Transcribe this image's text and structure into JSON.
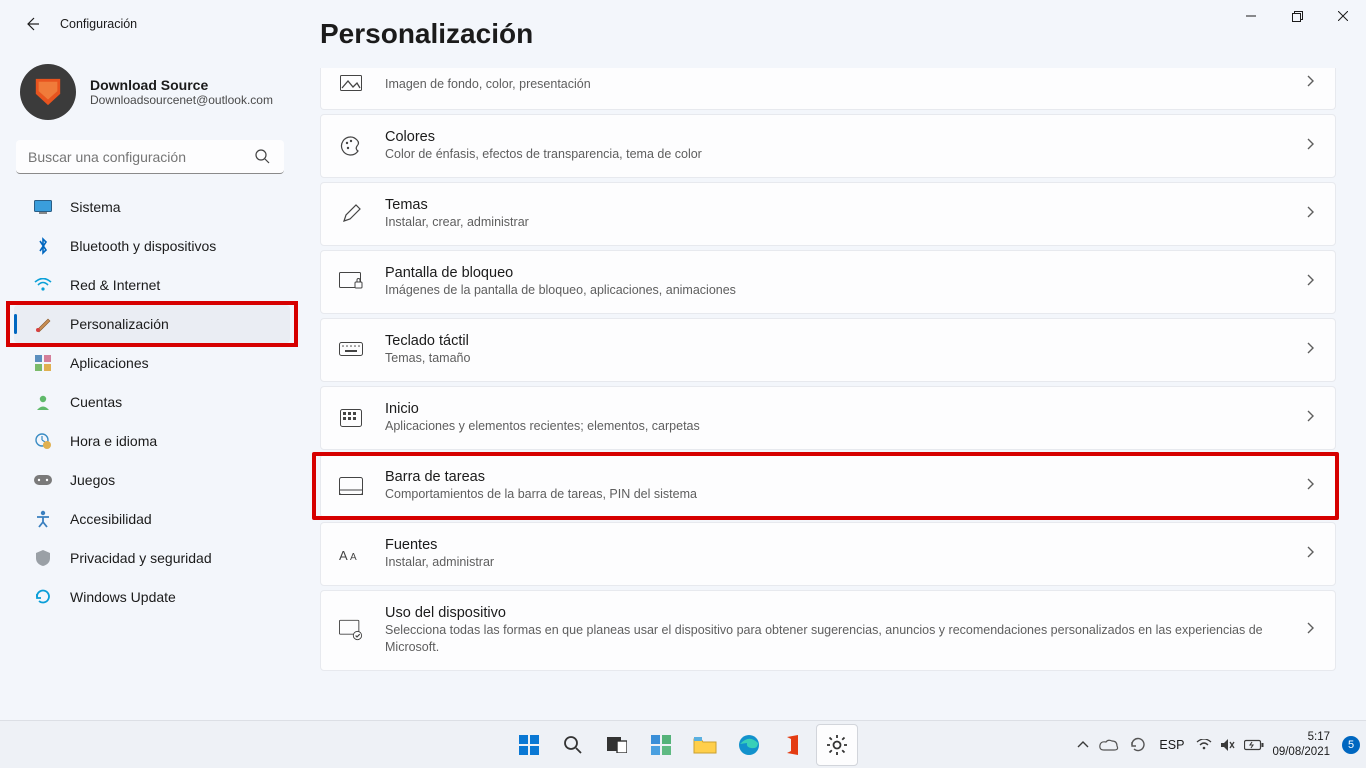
{
  "titlebar": {
    "app_name": "Configuración"
  },
  "user": {
    "name": "Download Source",
    "email": "Downloadsourcenet@outlook.com"
  },
  "search": {
    "placeholder": "Buscar una configuración"
  },
  "nav": {
    "items": [
      {
        "label": "Sistema",
        "icon": "monitor-icon"
      },
      {
        "label": "Bluetooth y dispositivos",
        "icon": "bluetooth-icon"
      },
      {
        "label": "Red & Internet",
        "icon": "wifi-icon"
      },
      {
        "label": "Personalización",
        "icon": "brush-icon",
        "selected": true,
        "annotated": true
      },
      {
        "label": "Aplicaciones",
        "icon": "apps-icon"
      },
      {
        "label": "Cuentas",
        "icon": "person-icon"
      },
      {
        "label": "Hora e idioma",
        "icon": "globe-clock-icon"
      },
      {
        "label": "Juegos",
        "icon": "gamepad-icon"
      },
      {
        "label": "Accesibilidad",
        "icon": "accessibility-icon"
      },
      {
        "label": "Privacidad y seguridad",
        "icon": "shield-icon"
      },
      {
        "label": "Windows Update",
        "icon": "update-icon"
      }
    ]
  },
  "page": {
    "title": "Personalización",
    "cards": [
      {
        "title": "",
        "desc": "Imagen de fondo, color, presentación",
        "icon": "background-icon",
        "truncated_top": true
      },
      {
        "title": "Colores",
        "desc": "Color de énfasis, efectos de transparencia, tema de color",
        "icon": "palette-icon"
      },
      {
        "title": "Temas",
        "desc": "Instalar, crear, administrar",
        "icon": "pen-icon"
      },
      {
        "title": "Pantalla de bloqueo",
        "desc": "Imágenes de la pantalla de bloqueo, aplicaciones, animaciones",
        "icon": "lockscreen-icon"
      },
      {
        "title": "Teclado táctil",
        "desc": "Temas, tamaño",
        "icon": "keyboard-touch-icon"
      },
      {
        "title": "Inicio",
        "desc": "Aplicaciones y elementos recientes; elementos, carpetas",
        "icon": "start-icon"
      },
      {
        "title": "Barra de tareas",
        "desc": "Comportamientos de la barra de tareas, PIN del sistema",
        "icon": "taskbar-icon",
        "annotated": true
      },
      {
        "title": "Fuentes",
        "desc": "Instalar, administrar",
        "icon": "font-icon"
      },
      {
        "title": "Uso del dispositivo",
        "desc": "Selecciona todas las formas en que planeas usar el dispositivo para obtener sugerencias, anuncios y recomendaciones personalizados en las experiencias de Microsoft.",
        "icon": "device-usage-icon"
      }
    ]
  },
  "taskbar": {
    "tray_lang": "ESP",
    "time": "5:17",
    "date": "09/08/2021",
    "notif_count": "5"
  }
}
